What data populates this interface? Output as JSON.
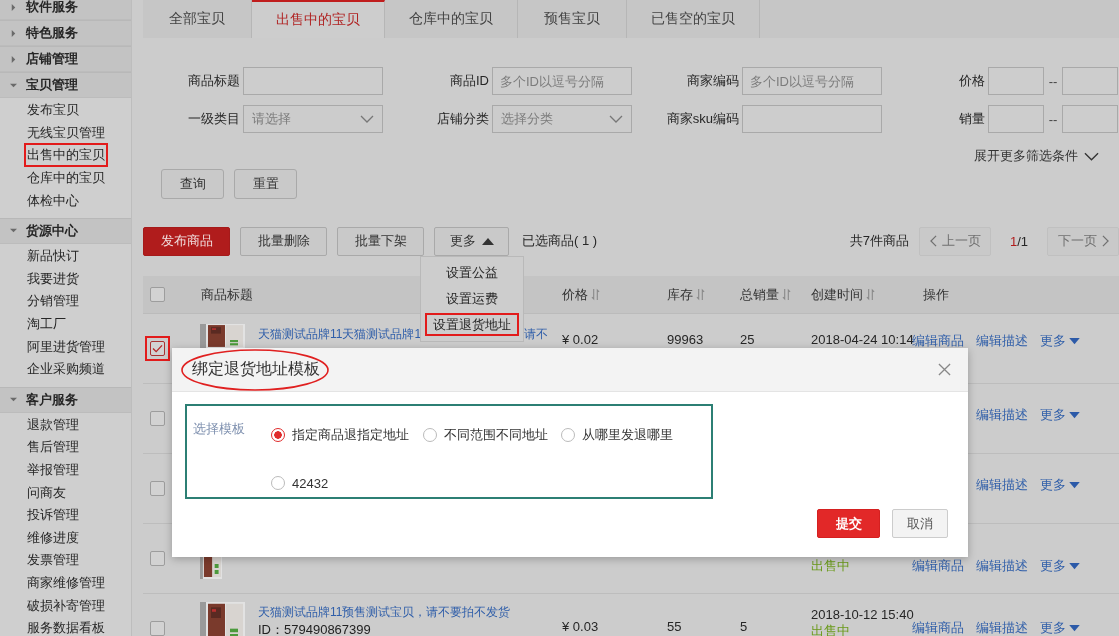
{
  "sidebar": {
    "groups": [
      {
        "title": "软件服务",
        "expanded": false
      },
      {
        "title": "特色服务",
        "expanded": false
      },
      {
        "title": "店铺管理",
        "expanded": false
      },
      {
        "title": "宝贝管理",
        "expanded": true,
        "items": [
          {
            "label": "发布宝贝",
            "annotated": false
          },
          {
            "label": "无线宝贝管理",
            "annotated": false
          },
          {
            "label": "出售中的宝贝",
            "annotated": true
          },
          {
            "label": "仓库中的宝贝",
            "annotated": false
          },
          {
            "label": "体检中心",
            "annotated": false
          }
        ]
      },
      {
        "title": "货源中心",
        "expanded": true,
        "items": [
          {
            "label": "新品快订",
            "annotated": false
          },
          {
            "label": "我要进货",
            "annotated": false
          },
          {
            "label": "分销管理",
            "annotated": false
          },
          {
            "label": "淘工厂",
            "annotated": false
          },
          {
            "label": "阿里进货管理",
            "annotated": false
          },
          {
            "label": "企业采购频道",
            "annotated": false
          }
        ]
      },
      {
        "title": "客户服务",
        "expanded": true,
        "items": [
          {
            "label": "退款管理",
            "annotated": false
          },
          {
            "label": "售后管理",
            "annotated": false
          },
          {
            "label": "举报管理",
            "annotated": false
          },
          {
            "label": "问商友",
            "annotated": false
          },
          {
            "label": "投诉管理",
            "annotated": false
          },
          {
            "label": "维修进度",
            "annotated": false
          },
          {
            "label": "发票管理",
            "annotated": false
          },
          {
            "label": "商家维修管理",
            "annotated": false
          },
          {
            "label": "破损补寄管理",
            "annotated": false
          },
          {
            "label": "服务数据看板",
            "annotated": false
          }
        ]
      }
    ]
  },
  "tabs": [
    {
      "label": "全部宝贝",
      "selected": false
    },
    {
      "label": "出售中的宝贝",
      "selected": true
    },
    {
      "label": "仓库中的宝贝",
      "selected": false
    },
    {
      "label": "预售宝贝",
      "selected": false
    },
    {
      "label": "已售空的宝贝",
      "selected": false
    }
  ],
  "filters": [
    {
      "label": "商品标题",
      "kind": "text"
    },
    {
      "label": "商品ID",
      "kind": "text",
      "placeholder": "多个ID以逗号分隔"
    },
    {
      "label": "商家编码",
      "kind": "text",
      "placeholder": "多个ID以逗号分隔"
    },
    {
      "label": "价格",
      "kind": "range",
      "separator": "--"
    },
    {
      "label": "一级类目",
      "kind": "select",
      "placeholder": "请选择"
    },
    {
      "label": "店铺分类",
      "kind": "select",
      "placeholder": "选择分类"
    },
    {
      "label": "商家sku编码",
      "kind": "text"
    },
    {
      "label": "销量",
      "kind": "range",
      "separator": "--"
    }
  ],
  "expand_filters": "展开更多筛选条件",
  "filter_buttons": [
    "查询",
    "重置"
  ],
  "toolbar": {
    "buttons": [
      {
        "label": "发布商品",
        "kind": "primary"
      },
      {
        "label": "批量删除",
        "kind": "default"
      },
      {
        "label": "批量下架",
        "kind": "default"
      },
      {
        "label": "更多",
        "kind": "dropdown",
        "expanded": true
      }
    ],
    "selected_count": "已选商品( 1 )",
    "total": "共7件商品",
    "pager": {
      "prev": "上一页",
      "next": "下一页",
      "current": "1",
      "rest": "/1",
      "prev_disabled": true,
      "next_disabled": true
    }
  },
  "more_menu": [
    {
      "label": "设置公益",
      "annotated": false
    },
    {
      "label": "设置运费",
      "annotated": false
    },
    {
      "label": "设置退货地址",
      "annotated": true
    }
  ],
  "table": {
    "columns": [
      {
        "label": "商品标题",
        "sortable": false
      },
      {
        "label": "价格",
        "sortable": true
      },
      {
        "label": "库存",
        "sortable": true
      },
      {
        "label": "总销量",
        "sortable": true
      },
      {
        "label": "创建时间",
        "sortable": true
      },
      {
        "label": "操作",
        "sortable": false
      }
    ],
    "all_checked": false,
    "rows": [
      {
        "checked": true,
        "annotated": true,
        "thumbnail": true,
        "title": "天猫测试品牌11天猫测试品牌1",
        "title_tail": "请不",
        "price": "¥ 0.02",
        "stock": "99963",
        "sales": "25",
        "created": "2018-04-24 10:14",
        "actions": [
          {
            "label": "编辑商品",
            "kind": "link"
          },
          {
            "label": "编辑描述",
            "kind": "link"
          },
          {
            "label": "更多",
            "kind": "menu"
          }
        ]
      },
      {
        "checked": false,
        "annotated": false,
        "actions": [
          {
            "label": "编辑描述",
            "kind": "link"
          },
          {
            "label": "更多",
            "kind": "menu"
          }
        ]
      },
      {
        "checked": false,
        "annotated": false,
        "actions": [
          {
            "label": "编辑描述",
            "kind": "link"
          },
          {
            "label": "更多",
            "kind": "menu"
          }
        ]
      },
      {
        "checked": false,
        "annotated": false,
        "thumbnail": true,
        "status": "出售中",
        "actions": [
          {
            "label": "编辑商品",
            "kind": "link"
          },
          {
            "label": "编辑描述",
            "kind": "link"
          },
          {
            "label": "更多",
            "kind": "menu"
          }
        ]
      },
      {
        "checked": false,
        "annotated": false,
        "thumbnail": true,
        "title": "天猫测试品牌11预售测试宝贝，请不要拍不发货",
        "id": "ID：579490867399",
        "price": "¥ 0.03",
        "stock": "55",
        "sales": "5",
        "created": "2018-10-12 15:40",
        "status": "出售中",
        "actions": [
          {
            "label": "编辑商品",
            "kind": "link"
          },
          {
            "label": "编辑描述",
            "kind": "link"
          },
          {
            "label": "更多",
            "kind": "menu"
          }
        ]
      }
    ]
  },
  "modal": {
    "title": "绑定退货地址模板",
    "title_circled": true,
    "field_label": "选择模板",
    "options_boxed": true,
    "options": [
      {
        "label": "指定商品退指定地址",
        "selected": true
      },
      {
        "label": "不同范围不同地址",
        "selected": false
      },
      {
        "label": "从哪里发退哪里",
        "selected": false
      },
      {
        "label": "42432",
        "selected": false
      }
    ],
    "buttons": [
      {
        "label": "提交",
        "kind": "primary"
      },
      {
        "label": "取消",
        "kind": "default"
      }
    ]
  }
}
